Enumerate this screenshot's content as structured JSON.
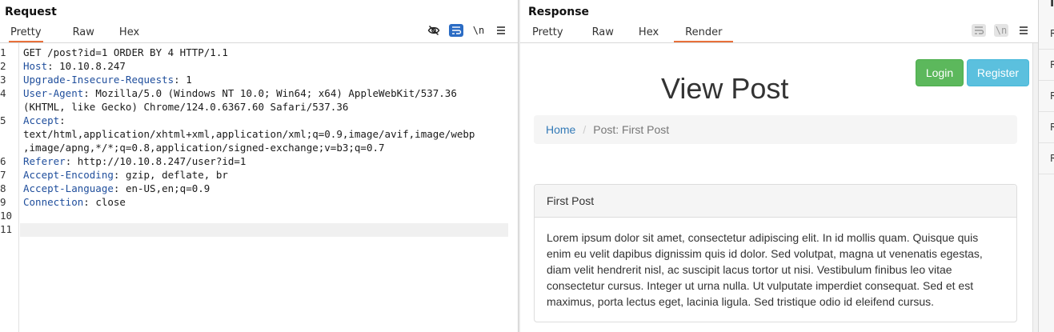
{
  "request": {
    "title": "Request",
    "tabs": [
      {
        "label": "Pretty",
        "active": true
      },
      {
        "label": "Raw",
        "active": false
      },
      {
        "label": "Hex",
        "active": false
      }
    ],
    "toolbar": {
      "hide_icon": "eye-slash-icon",
      "wrap_icon": "wrap-icon",
      "newline_label": "\\n",
      "menu_icon": "hamburger-icon"
    },
    "lines": [
      {
        "n": "1",
        "key": "",
        "rest": "GET /post?id=1 ORDER BY 4 HTTP/1.1"
      },
      {
        "n": "2",
        "key": "Host",
        "rest": ": 10.10.8.247"
      },
      {
        "n": "3",
        "key": "Upgrade-Insecure-Requests",
        "rest": ": 1"
      },
      {
        "n": "4",
        "key": "User-Agent",
        "rest": ": Mozilla/5.0 (Windows NT 10.0; Win64; x64) AppleWebKit/537.36"
      },
      {
        "n": "",
        "key": "",
        "rest": "(KHTML, like Gecko) Chrome/124.0.6367.60 Safari/537.36"
      },
      {
        "n": "5",
        "key": "Accept",
        "rest": ":"
      },
      {
        "n": "",
        "key": "",
        "rest": "text/html,application/xhtml+xml,application/xml;q=0.9,image/avif,image/webp"
      },
      {
        "n": "",
        "key": "",
        "rest": ",image/apng,*/*;q=0.8,application/signed-exchange;v=b3;q=0.7"
      },
      {
        "n": "6",
        "key": "Referer",
        "rest": ": http://10.10.8.247/user?id=1"
      },
      {
        "n": "7",
        "key": "Accept-Encoding",
        "rest": ": gzip, deflate, br"
      },
      {
        "n": "8",
        "key": "Accept-Language",
        "rest": ": en-US,en;q=0.9"
      },
      {
        "n": "9",
        "key": "Connection",
        "rest": ": close"
      },
      {
        "n": "10",
        "key": "",
        "rest": ""
      },
      {
        "n": "11",
        "key": "",
        "rest": ""
      }
    ]
  },
  "response": {
    "title": "Response",
    "tabs": [
      {
        "label": "Pretty",
        "active": false
      },
      {
        "label": "Raw",
        "active": false
      },
      {
        "label": "Hex",
        "active": false
      },
      {
        "label": "Render",
        "active": true
      }
    ],
    "toolbar": {
      "wrap_icon": "wrap-icon",
      "newline_label": "\\n",
      "menu_icon": "hamburger-icon"
    },
    "render": {
      "login_label": "Login",
      "register_label": "Register",
      "heading": "View Post",
      "breadcrumb_home": "Home",
      "breadcrumb_sep": "/",
      "breadcrumb_current": "Post: First Post",
      "post_title": "First Post",
      "post_body": "Lorem ipsum dolor sit amet, consectetur adipiscing elit. In id mollis quam. Quisque quis enim eu velit dapibus dignissim quis id dolor. Sed volutpat, magna ut venenatis egestas, diam velit hendrerit nisl, ac suscipit lacus tortor ut nisi. Vestibulum finibus leo vitae consectetur cursus. Integer ut urna nulla. Ut vulputate imperdiet consequat. Sed et est maximus, porta lectus eget, lacinia ligula. Sed tristique odio id eleifend cursus."
    }
  },
  "inspector": {
    "header": "In",
    "rows": [
      "R",
      "R",
      "R",
      "R",
      "R"
    ]
  },
  "colors": {
    "accent": "#e8703a",
    "header_key": "#1f4e9c",
    "login": "#5cb85c",
    "register": "#5bc0de",
    "link": "#337ab7"
  }
}
